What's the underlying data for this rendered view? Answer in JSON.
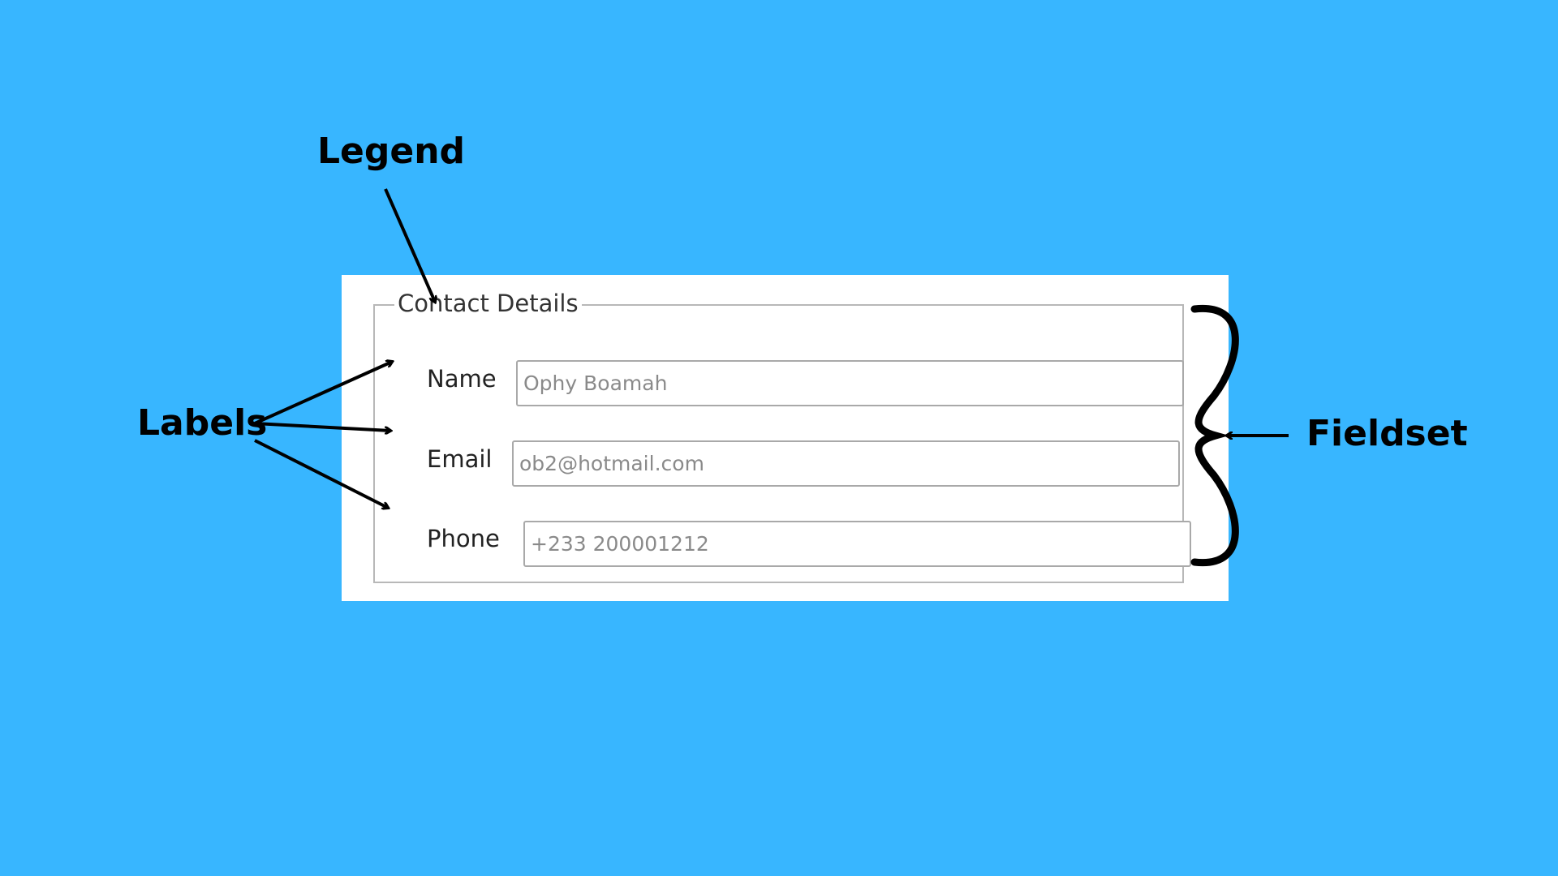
{
  "annotations": {
    "legend": "Legend",
    "labels": "Labels",
    "fieldset": "Fieldset"
  },
  "form": {
    "legend": "Contact Details",
    "fields": [
      {
        "label": "Name",
        "placeholder": "Ophy Boamah"
      },
      {
        "label": "Email",
        "placeholder": "ob2@hotmail.com"
      },
      {
        "label": "Phone",
        "placeholder": "+233 200001212"
      }
    ]
  },
  "colors": {
    "background": "#38b6ff",
    "panel": "#ffffff",
    "border": "#b8b8b8",
    "annotation": "#000000"
  }
}
